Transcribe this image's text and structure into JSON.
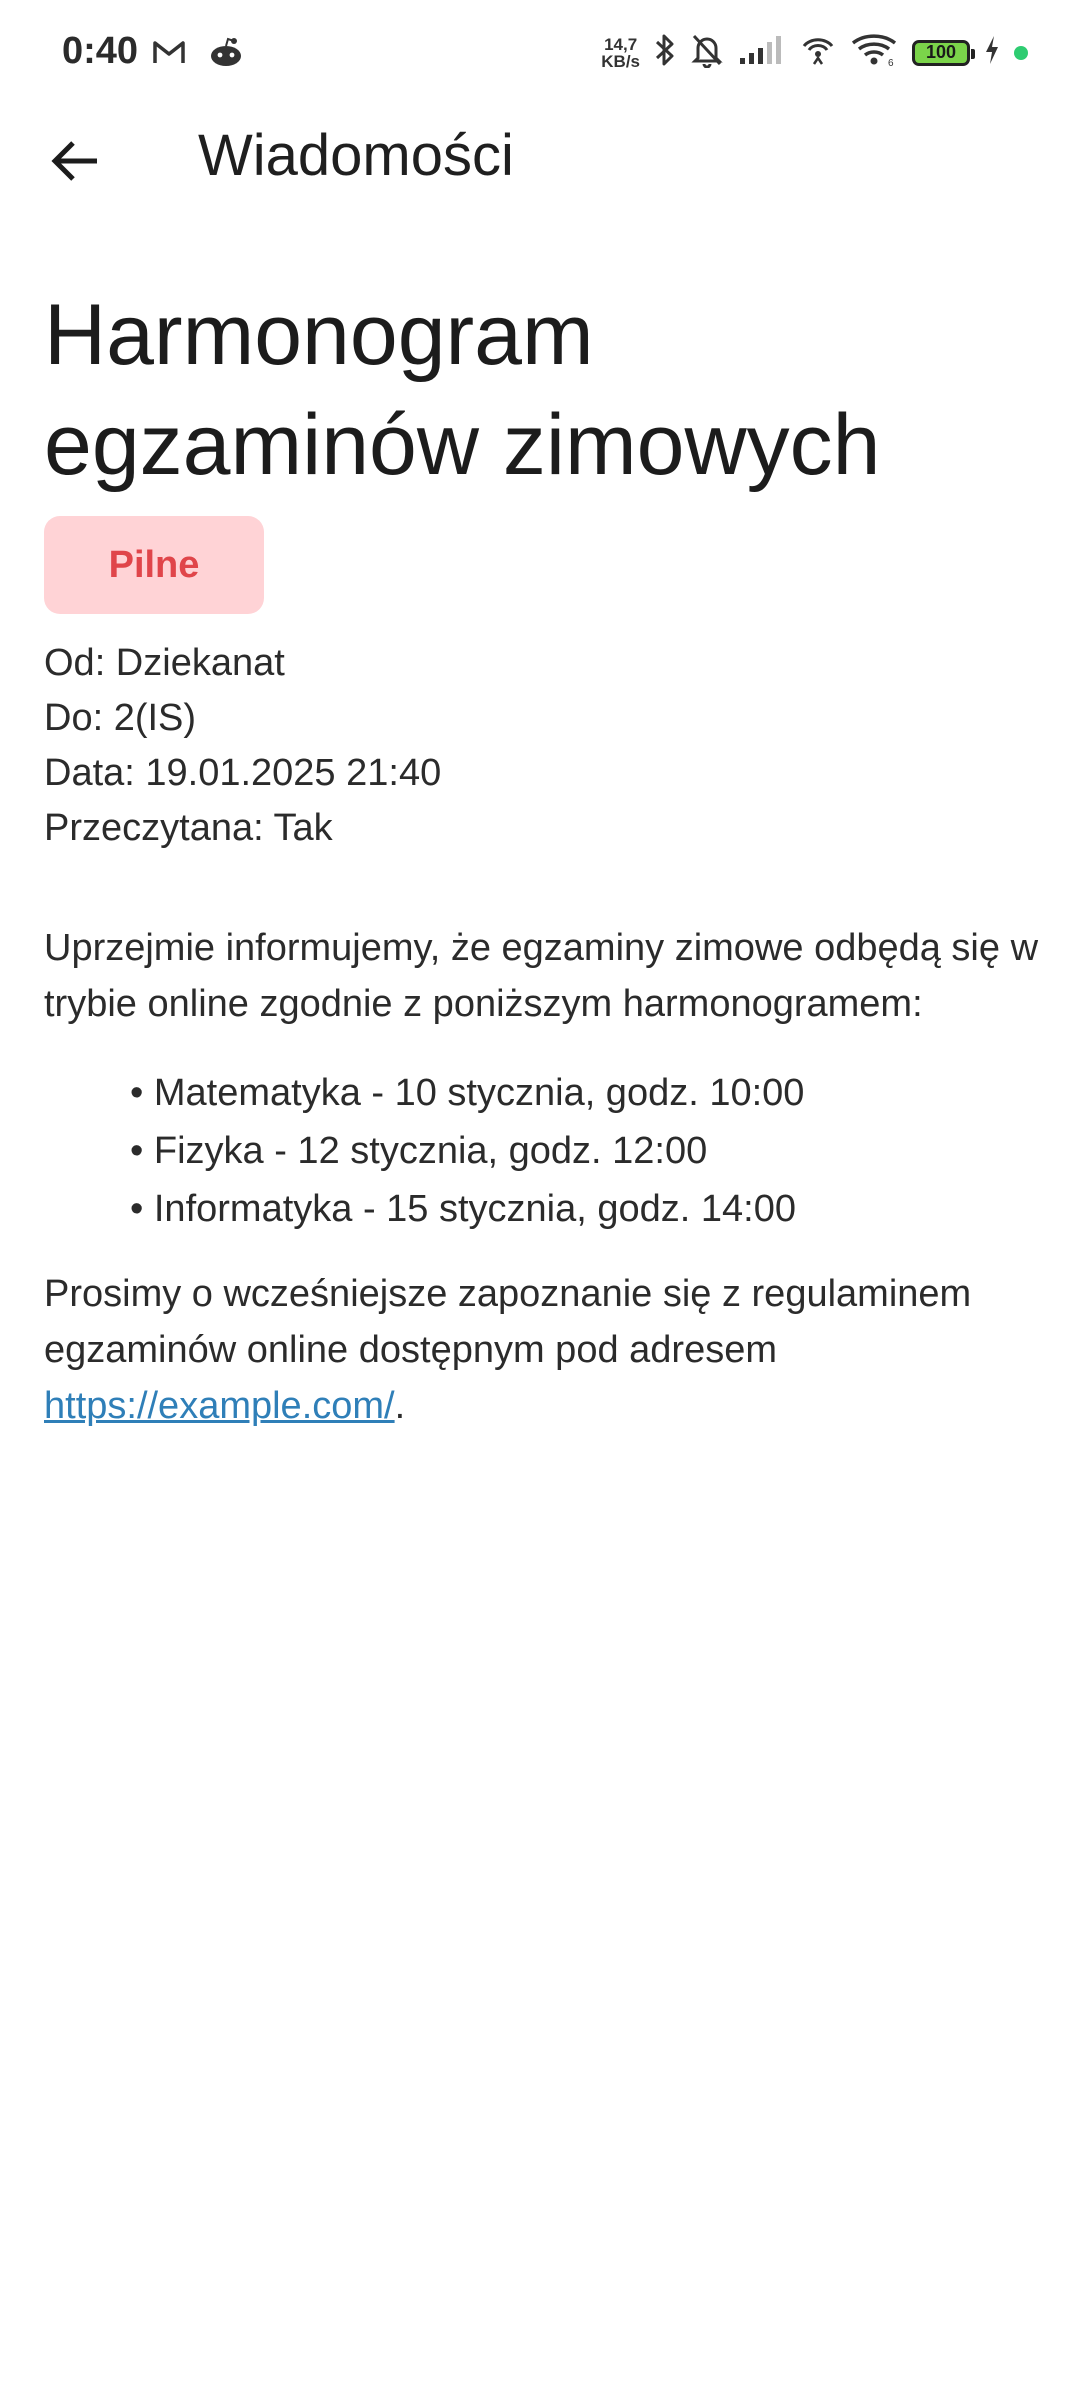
{
  "status_bar": {
    "time": "0:40",
    "net_speed_value": "14,7",
    "net_speed_unit": "KB/s",
    "battery_level": "100",
    "left_icons": [
      "gmail-icon",
      "reddit-icon"
    ],
    "right_icons": [
      "bluetooth-icon",
      "bell-muted-icon",
      "signal-icon",
      "hotspot-icon",
      "wifi-icon",
      "battery-icon",
      "charging-icon"
    ]
  },
  "app_bar": {
    "title": "Wiadomości",
    "back_icon": "arrow-left-icon"
  },
  "message": {
    "title": "Harmonogram egzaminów zimowych",
    "badge": "Pilne",
    "from": "Od: Dziekanat",
    "to": "Do: 2(IS)",
    "date": "Data: 19.01.2025 21:40",
    "read": "Przeczytana: Tak",
    "intro": "Uprzejmie informujemy, że egzaminy zimowe odbędą się w trybie online zgodnie z poniższym harmonogramem:",
    "exams": [
      "Matematyka - 10 stycznia, godz. 10:00",
      "Fizyka - 12 stycznia, godz. 12:00",
      "Informatyka - 15 stycznia, godz. 14:00"
    ],
    "outro_prefix": "Prosimy o wcześniejsze zapoznanie się z regulaminem egzaminów online dostępnym pod adresem ",
    "link": "https://example.com/",
    "outro_suffix": "."
  },
  "colors": {
    "badge_bg": "#ffd3d6",
    "badge_text": "#e0454a",
    "link": "#2f7fb8",
    "battery_fill": "#7bd44a",
    "status_dot": "#2ecc71"
  }
}
